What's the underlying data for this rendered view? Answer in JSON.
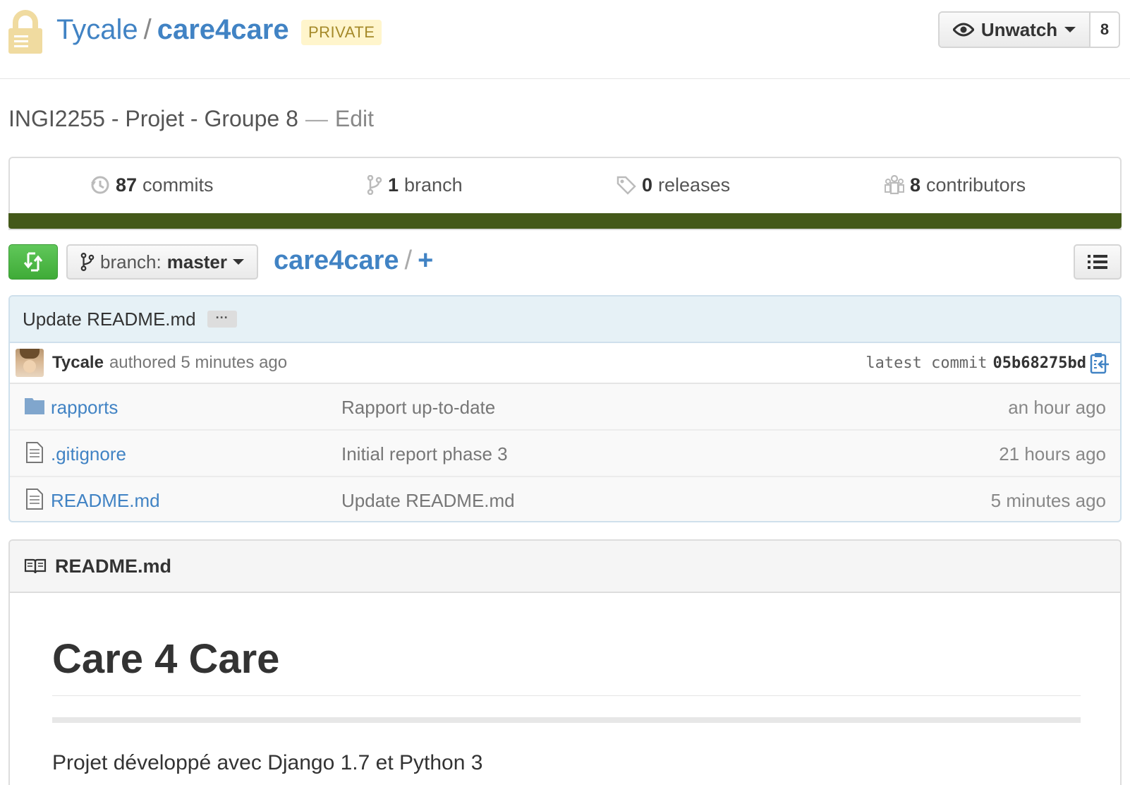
{
  "repo": {
    "owner": "Tycale",
    "separator": "/",
    "name": "care4care",
    "visibility": "PRIVATE",
    "lock_icon": "lock-icon"
  },
  "watch": {
    "label": "Unwatch",
    "count": "8",
    "icon": "eye-icon"
  },
  "description": {
    "text": "INGI2255 - Projet - Groupe 8",
    "dash": "—",
    "edit": "Edit"
  },
  "summary": {
    "commits": {
      "count": "87",
      "label": "commits",
      "icon": "history-icon"
    },
    "branches": {
      "count": "1",
      "label": "branch",
      "icon": "branch-icon"
    },
    "releases": {
      "count": "0",
      "label": "releases",
      "icon": "tag-icon"
    },
    "contributors": {
      "count": "8",
      "label": "contributors",
      "icon": "organization-icon"
    },
    "language_color": "#44591a"
  },
  "file_nav": {
    "compare_icon": "compare-icon",
    "branch_prefix": "branch:",
    "branch_name": "master",
    "breadcrumb_root": "care4care",
    "breadcrumb_sep": "/",
    "breadcrumb_add": "+",
    "list_icon": "list-icon"
  },
  "latest_commit": {
    "message": "Update README.md",
    "ellipsis": "···",
    "author": "Tycale",
    "authored_text": "authored 5 minutes ago",
    "label": "latest commit",
    "sha": "05b68275bd"
  },
  "files": [
    {
      "name": "rapports",
      "type": "directory",
      "message": "Rapport up-to-date",
      "age": "an hour ago"
    },
    {
      "name": ".gitignore",
      "type": "file",
      "message": "Initial report phase 3",
      "age": "21 hours ago"
    },
    {
      "name": "README.md",
      "type": "file",
      "message": "Update README.md",
      "age": "5 minutes ago"
    }
  ],
  "readme": {
    "filename": "README.md",
    "heading": "Care 4 Care",
    "paragraph": "Projet développé avec Django 1.7 et Python 3"
  },
  "colors": {
    "link": "#4183c4",
    "compare_button": "#4fb848",
    "private_badge_bg": "#fff5cc"
  }
}
